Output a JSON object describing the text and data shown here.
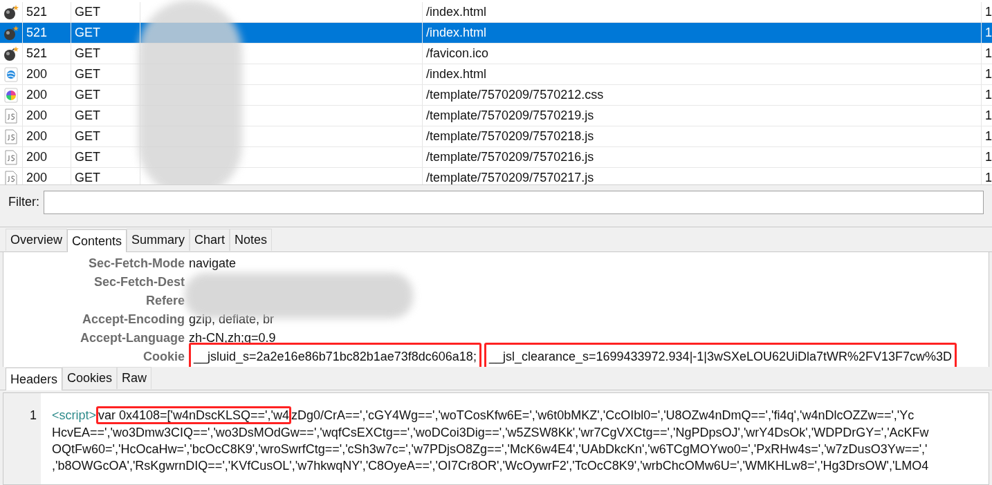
{
  "sessions": [
    {
      "kind": "error",
      "status": "521",
      "method": "GET",
      "url": "/index.html",
      "selected": false,
      "column_5": "1"
    },
    {
      "kind": "error",
      "status": "521",
      "method": "GET",
      "url": "/index.html",
      "selected": true,
      "column_5": "1"
    },
    {
      "kind": "error",
      "status": "521",
      "method": "GET",
      "url": "/favicon.ico",
      "selected": false,
      "column_5": "1"
    },
    {
      "kind": "html",
      "status": "200",
      "method": "GET",
      "url": "/index.html",
      "selected": false,
      "column_5": "1"
    },
    {
      "kind": "css",
      "status": "200",
      "method": "GET",
      "url": "/template/7570209/7570212.css",
      "selected": false,
      "column_5": "1"
    },
    {
      "kind": "script",
      "status": "200",
      "method": "GET",
      "url": "/template/7570209/7570219.js",
      "selected": false,
      "column_5": "1"
    },
    {
      "kind": "script",
      "status": "200",
      "method": "GET",
      "url": "/template/7570209/7570218.js",
      "selected": false,
      "column_5": "1"
    },
    {
      "kind": "script",
      "status": "200",
      "method": "GET",
      "url": "/template/7570209/7570216.js",
      "selected": false,
      "column_5": "1"
    },
    {
      "kind": "script",
      "status": "200",
      "method": "GET",
      "url": "/template/7570209/7570217.js",
      "selected": false,
      "column_5": "1"
    }
  ],
  "filter": {
    "label": "Filter:"
  },
  "tabs": [
    {
      "label": "Overview",
      "selected": false
    },
    {
      "label": "Contents",
      "selected": true
    },
    {
      "label": "Summary",
      "selected": false
    },
    {
      "label": "Chart",
      "selected": false
    },
    {
      "label": "Notes",
      "selected": false
    }
  ],
  "headers": [
    {
      "name": "Sec-Fetch-Mode",
      "values": [
        {
          "text": "navigate",
          "highlighted": false
        }
      ]
    },
    {
      "name": "Sec-Fetch-Dest"
    },
    {
      "name": "Refere"
    },
    {
      "name": "Accept-Encoding",
      "values": [
        {
          "text": "gzip, deflate, br",
          "highlighted": false
        }
      ]
    },
    {
      "name": "Accept-Language",
      "values": [
        {
          "text": "zh-CN,zh;q=0.9",
          "highlighted": false
        }
      ]
    },
    {
      "name": "Cookie",
      "values": [
        {
          "text": "__jsluid_s=2a2e16e86b71bc82b1ae73f8dc606a18;",
          "highlighted": true
        },
        {
          "text": "__jsl_clearance_s=1699433972.934|-1|3wSXeLOU62UiDla7tWR%2FV13F7cw%3D",
          "highlighted": true
        }
      ]
    }
  ],
  "subtabs": [
    {
      "label": "Headers",
      "selected": true
    },
    {
      "label": "Cookies",
      "selected": false
    },
    {
      "label": "Raw",
      "selected": false
    }
  ],
  "code": {
    "line_number": "1",
    "tag": "<script>",
    "lines": [
      [
        {
          "text": "var  0x4108=['w4nDscKLSQ==','w4",
          "highlighted": true
        },
        {
          "text": "zDg0/CrA==','cGY4Wg==','woTCosKfw6E=','w6t0bMKZ','CcOIbl0=','U8OZw4nDmQ==','fi4q','w4nDlcOZZw==','Yc",
          "highlighted": false
        }
      ],
      [
        {
          "text": "HcvEA==','wo3Dmw3CIQ==','wo3DsMOdGw==','wqfCsEXCtg==','woDCoi3Dig==','w5ZSW8Kk','wr7CgVXCtg==','NgPDpsOJ','wrY4DsOk','WDPDrGY=','AcKFw",
          "highlighted": false
        }
      ],
      [
        {
          "text": "OQtFw60=','HcOcaHw=','bcOcC8K9','wroSwrfCtg==','cSh3w7c=','w7PDjsO8Zg==','McK6w4E4','UAbDkcKn','w6TCgMOYwo0=','PxRHw4s=','w7zDusO3Yw==','",
          "highlighted": false
        }
      ],
      [
        {
          "text": ",'b8OWGcOA','RsKgwrnDIQ==','KVfCusOL','w7hkwqNY','C8OyeA==','OI7Cr8OR','WcOywrF2','TcOcC8K9','wrbChcOMw6U=','WMKHLw8=','Hg3DrsOW','LMO4",
          "highlighted": false
        }
      ]
    ]
  }
}
